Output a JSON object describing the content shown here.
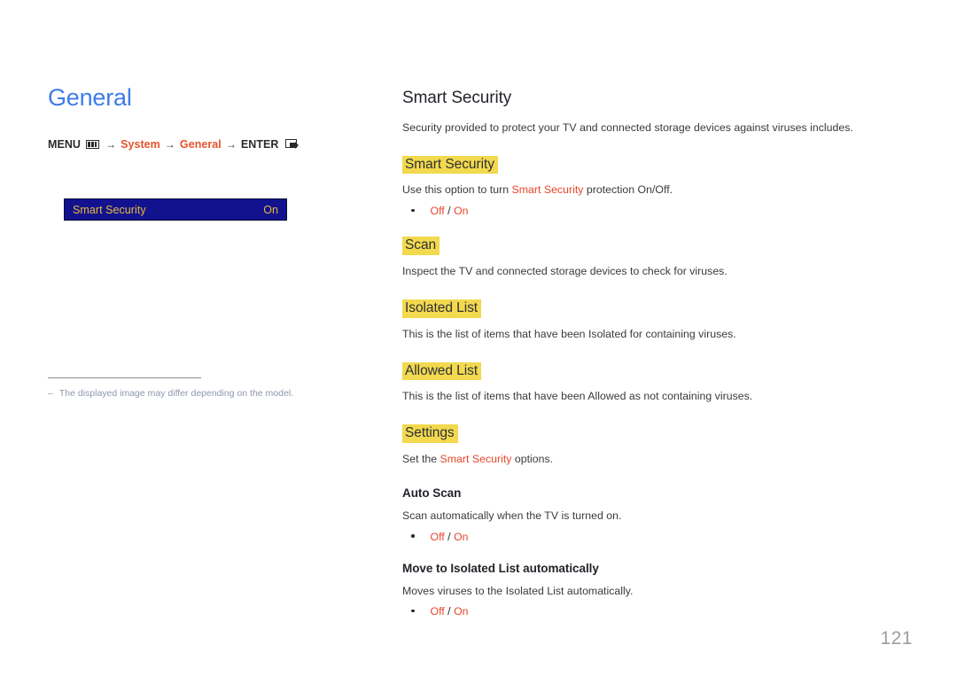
{
  "page": {
    "number": "121",
    "background": "#ffffff"
  },
  "colors": {
    "title_blue": "#3d7ce8",
    "accent_red": "#e8452b",
    "path_red": "#e8522b",
    "highlight_yellow": "#f2d94e",
    "menu_box_blue": "#12128f",
    "menu_box_text": "#e8b93a",
    "body_gray": "#3a3a3a",
    "footnote_gray": "#8f96b0",
    "page_number_gray": "#9d9d9d"
  },
  "left": {
    "title": "General",
    "menu_path": {
      "menu_label": "MENU",
      "menu_icon": "menu-grid-icon",
      "arrow1": "→",
      "step1": "System",
      "arrow2": "→",
      "step2": "General",
      "arrow3": "→",
      "enter_label": "ENTER",
      "enter_icon": "enter-return-icon"
    },
    "menu_box": {
      "label": "Smart Security",
      "value": "On"
    },
    "footnote": {
      "dash": "‒",
      "text": "The displayed image may differ depending on the model."
    }
  },
  "right": {
    "section_title": "Smart Security",
    "intro": "Security provided to protect your TV and connected storage devices against viruses includes.",
    "blocks": [
      {
        "type": "highlight",
        "heading": "Smart Security",
        "desc_pre": "Use this option to turn ",
        "desc_accent": "Smart Security",
        "desc_post": " protection On/Off.",
        "options": {
          "off": "Off",
          "sep": " / ",
          "on": "On"
        }
      },
      {
        "type": "highlight",
        "heading": "Scan",
        "desc": "Inspect the TV and connected storage devices to check for viruses."
      },
      {
        "type": "highlight",
        "heading": "Isolated List",
        "desc": "This is the list of items that have been Isolated for containing viruses."
      },
      {
        "type": "highlight",
        "heading": "Allowed List",
        "desc": "This is the list of items that have been Allowed as not containing viruses."
      },
      {
        "type": "highlight",
        "heading": "Settings",
        "desc_pre": "Set the ",
        "desc_accent": "Smart Security",
        "desc_post": " options."
      },
      {
        "type": "sub",
        "heading": "Auto Scan",
        "desc": "Scan automatically when the TV is turned on.",
        "options": {
          "off": "Off",
          "sep": " / ",
          "on": "On"
        }
      },
      {
        "type": "sub",
        "heading": "Move to Isolated List automatically",
        "desc": "Moves viruses to the Isolated List automatically.",
        "options": {
          "off": "Off",
          "sep": " / ",
          "on": "On"
        }
      }
    ]
  }
}
